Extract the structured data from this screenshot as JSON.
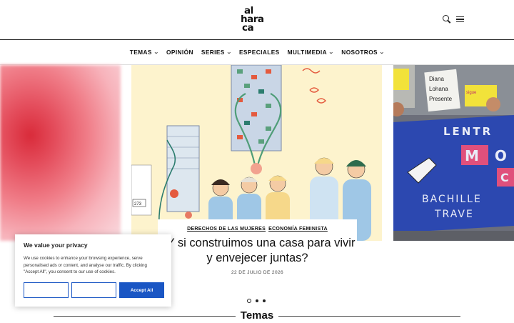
{
  "logo": {
    "line1": "al",
    "line2": "hara",
    "line3": "ca"
  },
  "header": {
    "search_icon": "search-icon",
    "menu_icon": "hamburger-menu-icon"
  },
  "nav": {
    "items": [
      {
        "label": "TEMAS",
        "has_dropdown": true
      },
      {
        "label": "OPINIÓN",
        "has_dropdown": false
      },
      {
        "label": "SERIES",
        "has_dropdown": true
      },
      {
        "label": "ESPECIALES",
        "has_dropdown": false
      },
      {
        "label": "MULTIMEDIA",
        "has_dropdown": true
      },
      {
        "label": "NOSOTROS",
        "has_dropdown": true
      }
    ],
    "chevron": "⌄"
  },
  "slider": {
    "featured": {
      "category1": "DERECHOS DE LAS MUJERES",
      "category2": "ECONOMÍA FEMINISTA",
      "headline": "¿Y si construimos una casa para vivir y envejecer juntas?",
      "date": "22 DE JULIO DE 2026"
    },
    "right_signs": {
      "sign1": "Diana Lohana Presente",
      "banner_line1": "LENTR",
      "banner_line2": "M O",
      "banner_line3": "C",
      "banner_line4": "BACHILLE",
      "banner_line5": "TRAVE",
      "sign2": "sigue"
    },
    "illustration_sign": "273",
    "dots_count": 3,
    "active_dot": 0
  },
  "section": {
    "title": "Temas"
  },
  "cookie": {
    "title": "We value your privacy",
    "text": "We use cookies to enhance your browsing experience, serve personalised ads or content, and analyse our traffic. By clicking \"Accept All\", you consent to our use of cookies.",
    "button1": "",
    "button2": "",
    "accept": "Accept All",
    "accent": "#1a56c4"
  }
}
